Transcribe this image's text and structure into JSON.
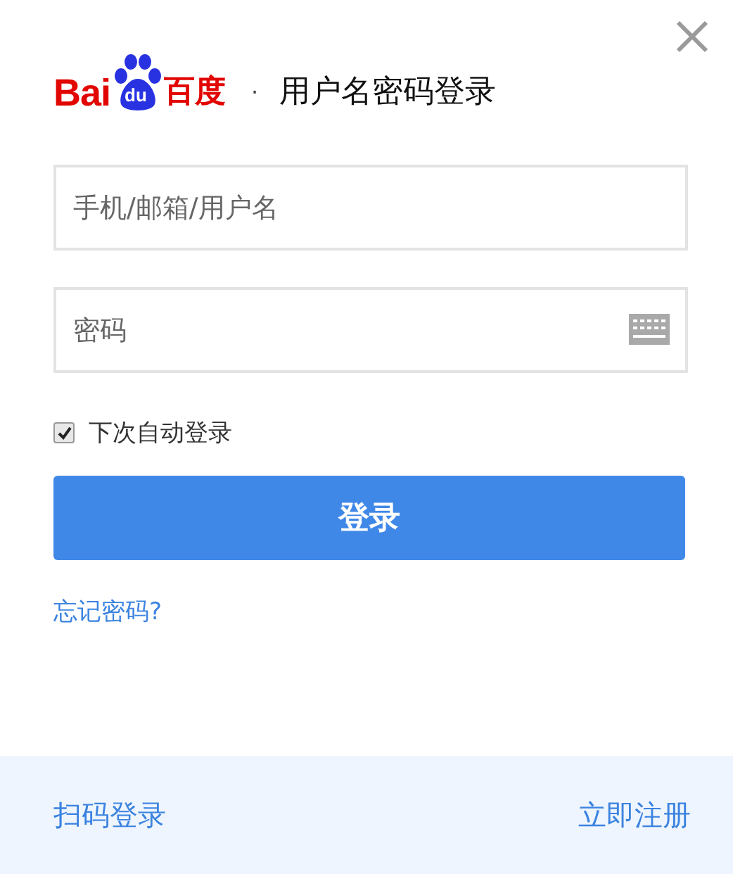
{
  "logo": {
    "latin": "Bai",
    "paw": "du",
    "chinese": "百度"
  },
  "separator": "·",
  "title": "用户名密码登录",
  "username": {
    "placeholder": "手机/邮箱/用户名"
  },
  "password": {
    "placeholder": "密码"
  },
  "remember": {
    "label": "下次自动登录",
    "checked": true
  },
  "login_button": "登录",
  "forgot_link": "忘记密码?",
  "footer": {
    "qr_login": "扫码登录",
    "register": "立即注册"
  }
}
